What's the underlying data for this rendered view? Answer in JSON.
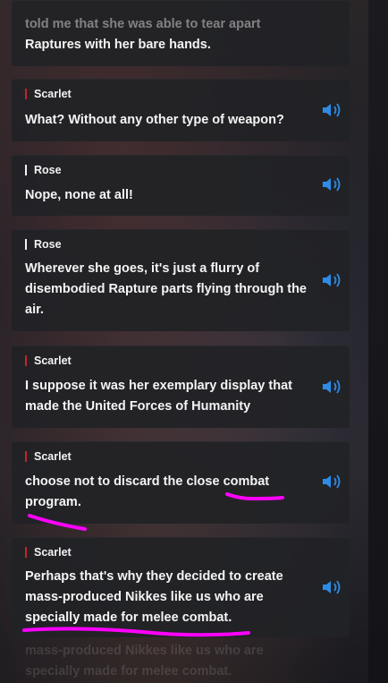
{
  "accent": {
    "bar_red": "#c0262c",
    "bar_white": "#f2f2f2",
    "speaker_blue": "#2e8be6",
    "highlight": "#ff00ff"
  },
  "partial_top": {
    "line1": "told me that she was able to tear apart",
    "line2": "Raptures with her bare hands."
  },
  "messages": [
    {
      "speaker": "Scarlet",
      "bar": "red",
      "text": "What? Without any other type of weapon?"
    },
    {
      "speaker": "Rose",
      "bar": "white",
      "text": "Nope, none at all!"
    },
    {
      "speaker": "Rose",
      "bar": "white",
      "text": "Wherever she goes, it's just a flurry of disembodied Rapture parts flying through the air."
    },
    {
      "speaker": "Scarlet",
      "bar": "red",
      "text": "I suppose it was her exemplary display that made the United Forces of Humanity"
    },
    {
      "speaker": "Scarlet",
      "bar": "red",
      "text": "choose not to discard the close combat program."
    },
    {
      "speaker": "Scarlet",
      "bar": "red",
      "text": "Perhaps that's why they decided to create mass-produced Nikkes like us who are specially made for melee combat."
    }
  ],
  "faded_bottom": {
    "line1": "mass-produced Nikkes like us who are",
    "line2": "specially made for melee combat."
  },
  "icons": {
    "speaker": "speaker-volume-icon"
  }
}
